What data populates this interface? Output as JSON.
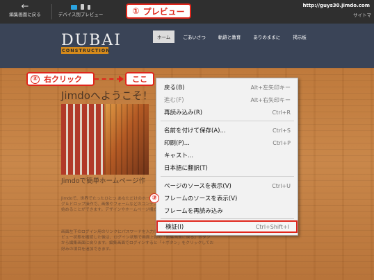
{
  "toolbar": {
    "back_label": "編集画面に戻る",
    "back_icon": "left-arrow-icon",
    "device_preview_label": "デバイス別プレビュー",
    "url": "http://guys30.jimdo.com",
    "sitemap": "サイトマ"
  },
  "callouts": {
    "step1_num": "①",
    "step1_text": "プレビュー",
    "step2_num": "②",
    "step2_text": "右クリック",
    "here_text": "ここ",
    "step3_num": "③"
  },
  "site": {
    "logo_main": "DUBAI",
    "logo_sub": "CONSTRUCTION",
    "nav": [
      "ホーム",
      "ごあいさつ",
      "軌跡と教育",
      "ありのままに",
      "掲示板"
    ],
    "welcome": "Jimdoへようこそ！",
    "subheading": "Jimdoで簡単ホームページ作",
    "para1": "Jimdoで、世界でたったひとつ あなただけのホームページを作成しましょう。ドラッグ＆ドロップ操作で、画像やフォームなどのコンテンツを追加するだけ、かんたんに始めることができます。デザインやホームページ構成も自由自在です。",
    "para2": "画面左下のログイン用のリンクにパスワードを入力してログインしてください。プレビュー状態を確認した後は、ログイン状態で画面上部の「編集画面に戻る」ボタンから編集画面に戻ります。編集画面でログインすると「＋ボタン」をクリックしてお好みの項目を追加できます。"
  },
  "context_menu": {
    "items": [
      {
        "label": "戻る(B)",
        "shortcut": "Alt+左矢印キー",
        "disabled": false
      },
      {
        "label": "進む(F)",
        "shortcut": "Alt+右矢印キー",
        "disabled": true
      },
      {
        "label": "再読み込み(R)",
        "shortcut": "Ctrl+R",
        "disabled": false
      },
      {
        "label": "名前を付けて保存(A)...",
        "shortcut": "Ctrl+S",
        "disabled": false
      },
      {
        "label": "印刷(P)...",
        "shortcut": "Ctrl+P",
        "disabled": false
      },
      {
        "label": "キャスト...",
        "shortcut": "",
        "disabled": false
      },
      {
        "label": "日本語に翻訳(T)",
        "shortcut": "",
        "disabled": false
      },
      {
        "label": "ページのソースを表示(V)",
        "shortcut": "Ctrl+U",
        "disabled": false
      },
      {
        "label": "フレームのソースを表示(V)",
        "shortcut": "",
        "disabled": false
      },
      {
        "label": "フレームを再読み込み",
        "shortcut": "",
        "disabled": false
      },
      {
        "label": "検証(I)",
        "shortcut": "Ctrl+Shift+I",
        "disabled": false
      }
    ]
  },
  "colors": {
    "accent_red": "#e0261b",
    "toolbar_bg": "#2f2f2f",
    "header_bg": "#3a4457",
    "logo_orange": "#d58a1b"
  }
}
